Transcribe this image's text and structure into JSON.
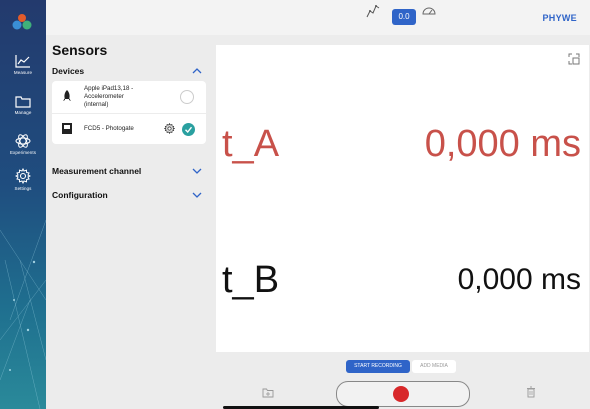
{
  "app": {
    "brand": "PHYWE",
    "mode_value": "0.0"
  },
  "nav": {
    "items": [
      {
        "label": "Measure",
        "icon": "chart-icon"
      },
      {
        "label": "Manage",
        "icon": "folder-icon"
      },
      {
        "label": "Experiments",
        "icon": "atom-icon"
      },
      {
        "label": "Settings",
        "icon": "gear-icon"
      }
    ]
  },
  "sensors": {
    "title": "Sensors",
    "devices_header": "Devices",
    "devices": [
      {
        "name": "Apple iPad13,18 - Accelerometer (internal)",
        "line1": "Apple iPad13,18 -",
        "line2": "Accelerometer",
        "line3": "(internal)",
        "selected": false
      },
      {
        "name": "FCD5 - Photogate",
        "selected": true
      }
    ],
    "measurement_header": "Measurement channel",
    "configuration_header": "Configuration"
  },
  "display": {
    "rows": [
      {
        "label": "t_A",
        "value": "0,000 ms",
        "color": "#c8514a"
      },
      {
        "label": "t_B",
        "value": "0,000 ms",
        "color": "#111111"
      }
    ]
  },
  "controls": {
    "start_recording": "START RECORDING",
    "add_media": "ADD MEDIA"
  },
  "colors": {
    "accent": "#2f64c8",
    "record": "#d8282a",
    "check": "#2aa0a0"
  }
}
